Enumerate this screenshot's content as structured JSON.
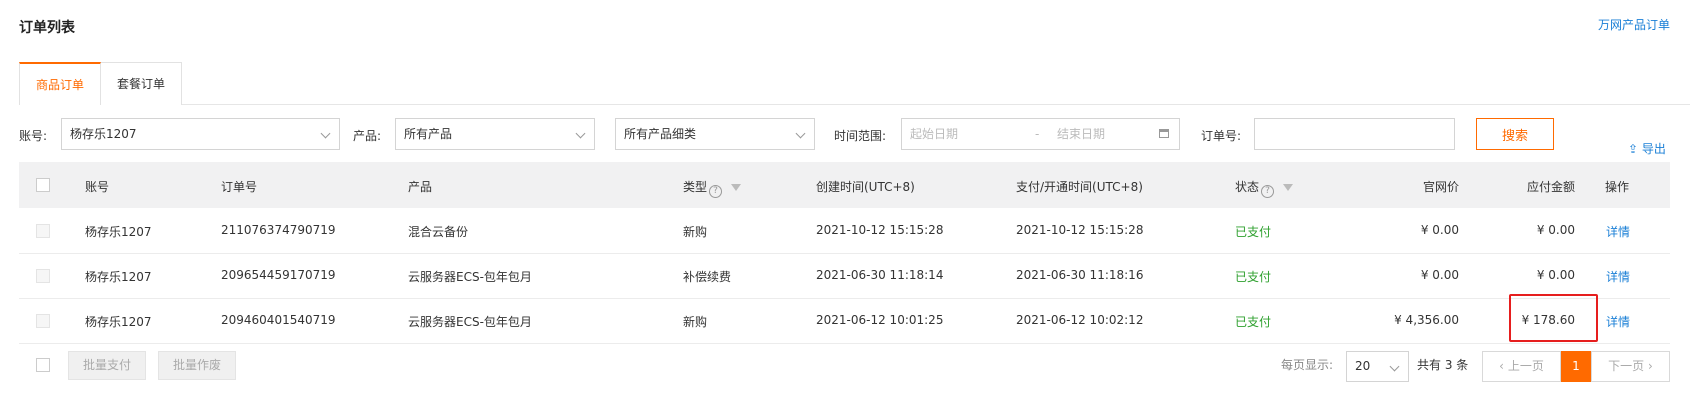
{
  "header": {
    "title": "订单列表",
    "link": "万网产品订单"
  },
  "tabs": [
    {
      "label": "商品订单"
    },
    {
      "label": "套餐订单"
    }
  ],
  "filters": {
    "account_label": "账号:",
    "account_value": "杨存乐1207",
    "product_label": "产品:",
    "product_value": "所有产品",
    "subcategory_value": "所有产品细类",
    "time_label": "时间范围:",
    "start_placeholder": "起始日期",
    "range_sep": "-",
    "end_placeholder": "结束日期",
    "order_label": "订单号:",
    "order_value": "",
    "search_label": "搜索",
    "export_label": "导出"
  },
  "table": {
    "columns": [
      "账号",
      "订单号",
      "产品",
      "类型",
      "创建时间(UTC+8)",
      "支付/开通时间(UTC+8)",
      "状态",
      "官网价",
      "应付金额",
      "操作"
    ],
    "rows": [
      {
        "account": "杨存乐1207",
        "order_no": "211076374790719",
        "product": "混合云备份",
        "type": "新购",
        "created": "2021-10-12 15:15:28",
        "paid_time": "2021-10-12 15:15:28",
        "status": "已支付",
        "list_price": "¥ 0.00",
        "payable": "¥ 0.00",
        "action": "详情"
      },
      {
        "account": "杨存乐1207",
        "order_no": "209654459170719",
        "product": "云服务器ECS-包年包月",
        "type": "补偿续费",
        "created": "2021-06-30 11:18:14",
        "paid_time": "2021-06-30 11:18:16",
        "status": "已支付",
        "list_price": "¥ 0.00",
        "payable": "¥ 0.00",
        "action": "详情"
      },
      {
        "account": "杨存乐1207",
        "order_no": "209460401540719",
        "product": "云服务器ECS-包年包月",
        "type": "新购",
        "created": "2021-06-12 10:01:25",
        "paid_time": "2021-06-12 10:02:12",
        "status": "已支付",
        "list_price": "¥ 4,356.00",
        "payable": "¥ 178.60",
        "action": "详情"
      }
    ]
  },
  "footer": {
    "batch_pay": "批量支付",
    "batch_void": "批量作废",
    "per_page_label": "每页显示:",
    "per_page_value": "20",
    "total_label": "共有 3 条",
    "prev_label": "上一页",
    "current_page": "1",
    "next_label": "下一页"
  },
  "colors": {
    "accent": "#ff6a00",
    "link": "#1a7fd6",
    "paid": "#2ea02e",
    "highlight": "#e61e1e"
  }
}
